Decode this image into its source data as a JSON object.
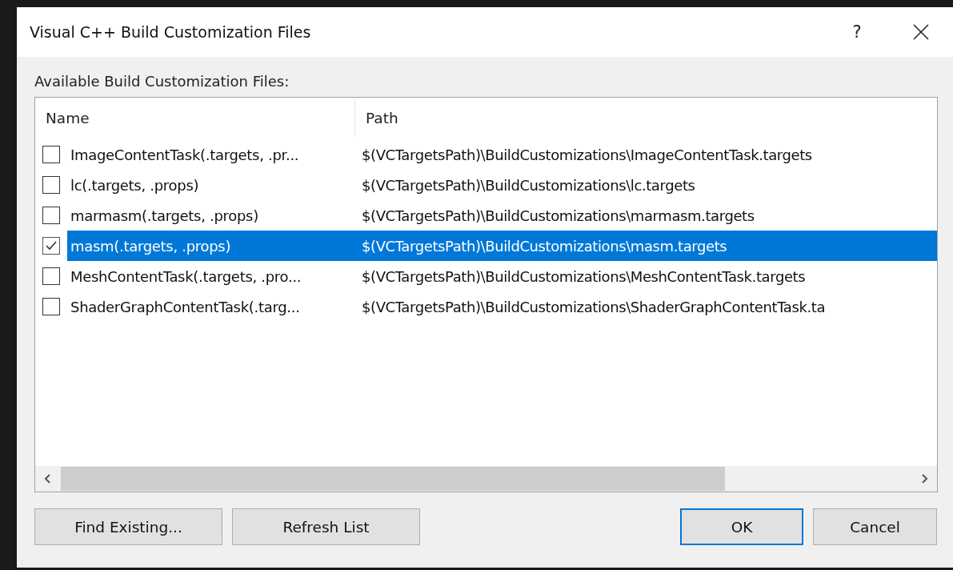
{
  "window": {
    "title": "Visual C++ Build Customization Files",
    "help": "?"
  },
  "list_label": "Available Build Customization Files:",
  "table": {
    "columns": [
      "Name",
      "Path"
    ],
    "rows": [
      {
        "name": "ImageContentTask(.targets, .pr...",
        "path": "$(VCTargetsPath)\\BuildCustomizations\\ImageContentTask.targets",
        "checked": false,
        "selected": false
      },
      {
        "name": "lc(.targets, .props)",
        "path": "$(VCTargetsPath)\\BuildCustomizations\\lc.targets",
        "checked": false,
        "selected": false
      },
      {
        "name": "marmasm(.targets, .props)",
        "path": "$(VCTargetsPath)\\BuildCustomizations\\marmasm.targets",
        "checked": false,
        "selected": false
      },
      {
        "name": "masm(.targets, .props)",
        "path": "$(VCTargetsPath)\\BuildCustomizations\\masm.targets",
        "checked": true,
        "selected": true
      },
      {
        "name": "MeshContentTask(.targets, .pro...",
        "path": "$(VCTargetsPath)\\BuildCustomizations\\MeshContentTask.targets",
        "checked": false,
        "selected": false
      },
      {
        "name": "ShaderGraphContentTask(.targ...",
        "path": "$(VCTargetsPath)\\BuildCustomizations\\ShaderGraphContentTask.ta",
        "checked": false,
        "selected": false
      }
    ]
  },
  "buttons": [
    {
      "label": "Find Existing...",
      "default": false
    },
    {
      "label": "Refresh List",
      "default": false
    },
    {
      "label": "OK",
      "default": true
    },
    {
      "label": "Cancel",
      "default": false
    }
  ]
}
